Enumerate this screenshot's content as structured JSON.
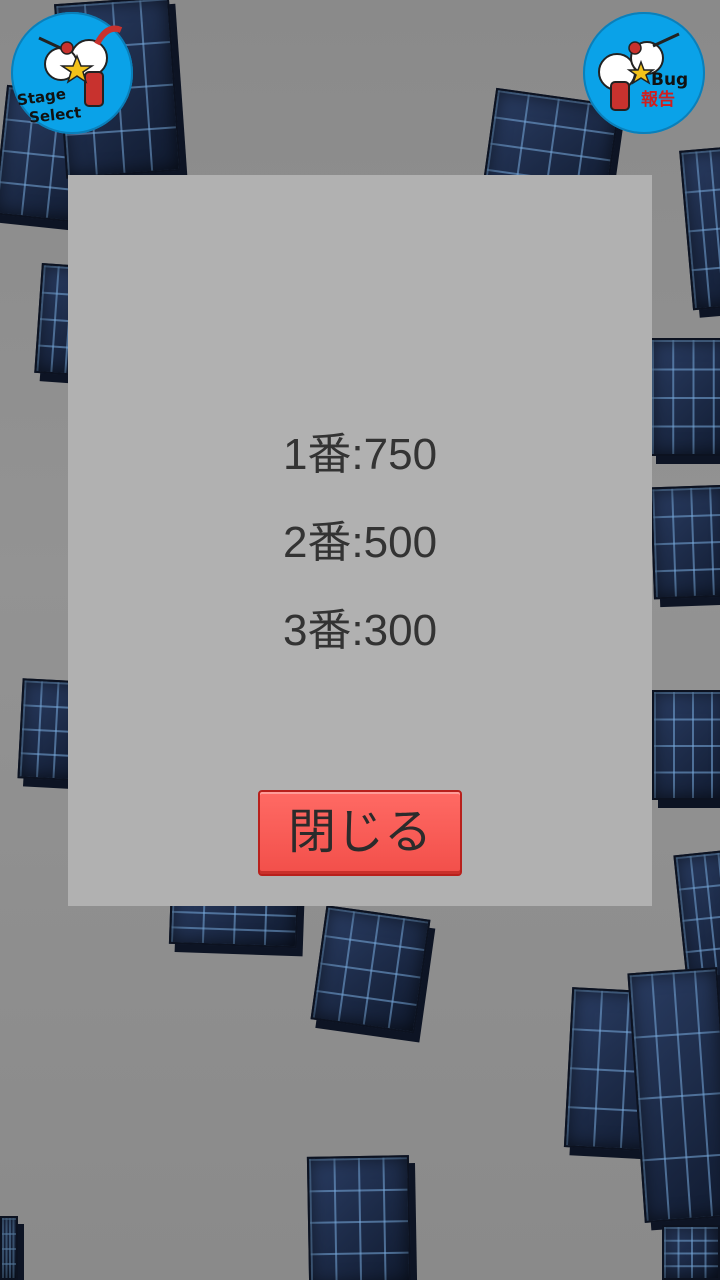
{
  "buttons": {
    "stage_select": {
      "line1": "Stage",
      "line2": "Select"
    },
    "bug_report": {
      "line1": "Bug",
      "line2": "報告"
    }
  },
  "dialog": {
    "scores": [
      "1番:750",
      "2番:500",
      "3番:300"
    ],
    "close_label": "閉じる"
  },
  "colors": {
    "dialog_bg": "#b1b1b1",
    "close_button": "#f24f4a",
    "corner_button": "#0aa2e8",
    "cube": "#1d2a45"
  }
}
